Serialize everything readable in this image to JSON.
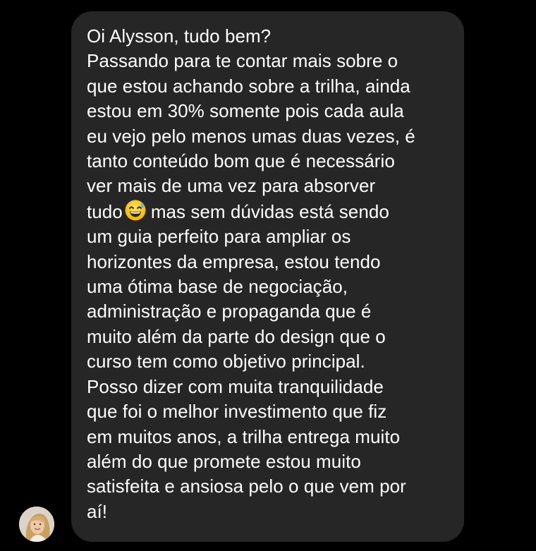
{
  "message": {
    "lines": [
      "Oi Alysson, tudo bem?",
      "Passando para te contar mais sobre o",
      "que estou achando sobre a trilha, ainda",
      "estou em 30% somente pois cada aula",
      "eu vejo pelo menos umas duas vezes, é",
      "tanto conteúdo bom que é necessário",
      "ver mais de uma vez para absorver",
      "tudo",
      "mas sem dúvidas está sendo",
      "um guia perfeito para ampliar os",
      "horizontes da empresa, estou tendo",
      "uma ótima base de negociação,",
      "administração e propaganda que é",
      "muito além da parte do design que o",
      "curso tem como objetivo principal.",
      "Posso dizer com muita tranquilidade",
      "que foi o melhor investimento que fiz",
      "em muitos anos, a trilha entrega muito",
      "além do que promete estou muito",
      "satisfeita e ansiosa pelo o que vem por",
      "aí!"
    ],
    "emoji": "grinning-face-with-sweat-emoji"
  },
  "sender": {
    "avatar": "profile-photo-avatar"
  },
  "colors": {
    "background": "#000000",
    "bubble": "#262626",
    "text": "#ffffff"
  }
}
